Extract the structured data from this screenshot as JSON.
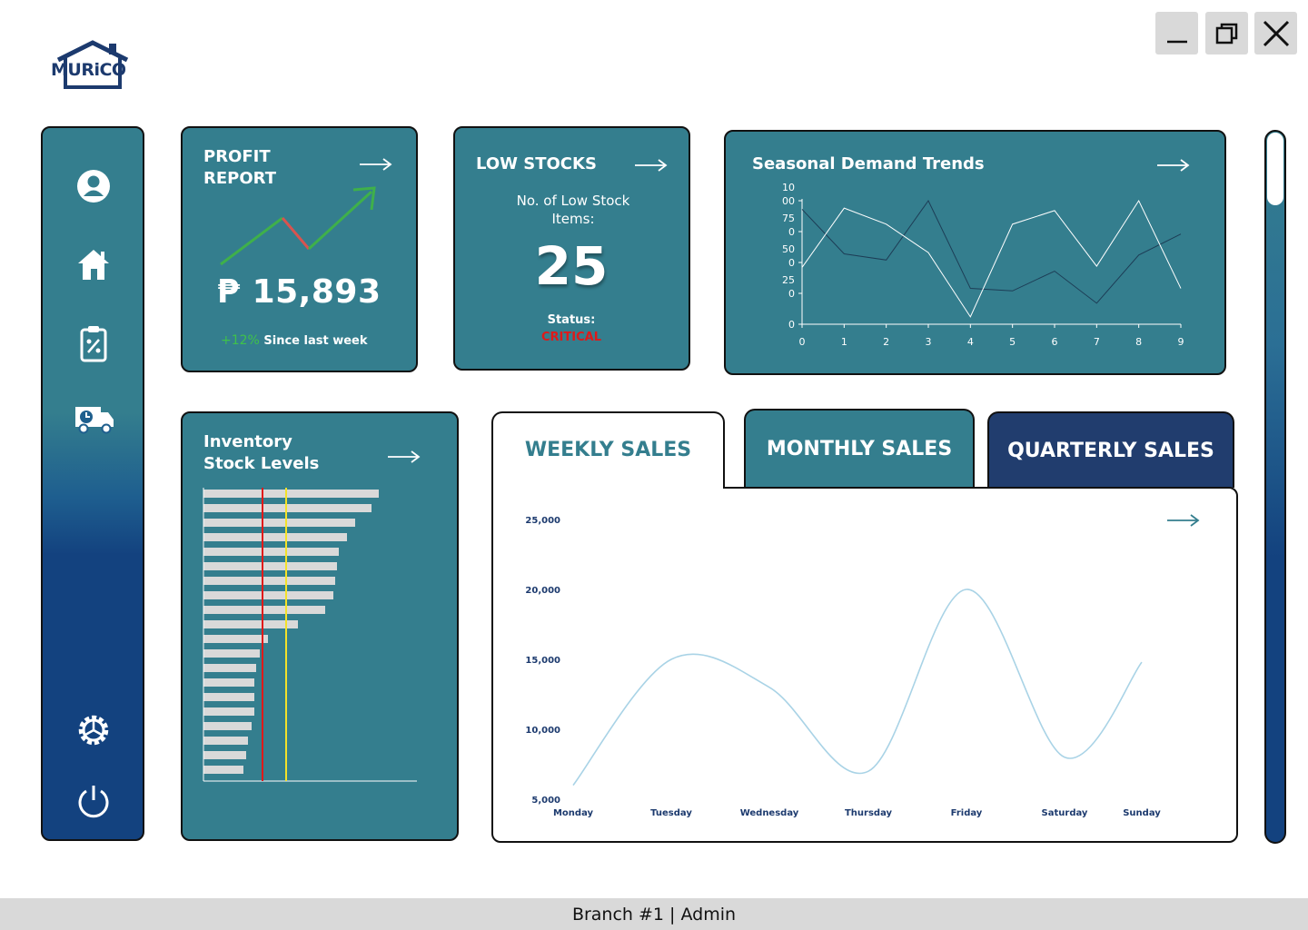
{
  "app": {
    "logo_text": "MURiCO"
  },
  "window_controls": {
    "minimize": "minimize-icon",
    "maximize": "maximize-icon",
    "close": "close-icon"
  },
  "sidebar": {
    "items": [
      {
        "icon": "user-icon"
      },
      {
        "icon": "home-icon"
      },
      {
        "icon": "clipboard-percent-icon"
      },
      {
        "icon": "delivery-truck-clock-icon"
      },
      {
        "icon": "settings-gear-icon"
      },
      {
        "icon": "power-icon"
      }
    ]
  },
  "profit_report": {
    "title_line1": "PROFIT",
    "title_line2": "REPORT",
    "value": "₱ 15,893",
    "change": "+12%",
    "change_label": "Since last week",
    "colors": {
      "up": "#3fb04a",
      "down": "#d9534f"
    }
  },
  "low_stocks": {
    "title": "LOW STOCKS",
    "subtitle_line1": "No. of Low Stock",
    "subtitle_line2": "Items:",
    "count": "25",
    "status_label": "Status:",
    "status_value": "CRITICAL",
    "status_color": "#e01919"
  },
  "seasonal": {
    "title": "Seasonal Demand Trends",
    "chart_data": {
      "type": "line",
      "x": [
        0,
        1,
        2,
        3,
        4,
        5,
        6,
        7,
        8,
        9
      ],
      "y_tick_labels": [
        "0",
        "25\n0",
        "50\n0",
        "75\n0",
        "10\n00"
      ],
      "ylim": [
        0,
        100
      ],
      "series": [
        {
          "values": [
            93,
            57,
            52,
            100,
            29,
            27,
            43,
            17,
            56,
            73
          ]
        },
        {
          "values": [
            46,
            94,
            81,
            58,
            6,
            81,
            92,
            47,
            100,
            29
          ]
        }
      ],
      "grid": false
    }
  },
  "inventory": {
    "title_line1": "Inventory",
    "title_line2": "Stock Levels",
    "chart_data": {
      "type": "bar",
      "orientation": "horizontal",
      "values": [
        193,
        185,
        167,
        158,
        149,
        147,
        145,
        143,
        134,
        104,
        71,
        62,
        58,
        56,
        56,
        56,
        53,
        49,
        47,
        44
      ],
      "xlim": [
        0,
        235
      ],
      "reference_lines": [
        {
          "value": 65,
          "color": "#e01919"
        },
        {
          "value": 91,
          "color": "#f4e229"
        }
      ],
      "bar_color": "#d9d9d9"
    }
  },
  "sales_tabs": {
    "weekly": "WEEKLY SALES",
    "monthly": "MONTHLY SALES",
    "quarterly": "QUARTERLY SALES",
    "active": "weekly"
  },
  "weekly_sales": {
    "chart_data": {
      "type": "line",
      "categories": [
        "Monday",
        "Tuesday",
        "Wednesday",
        "Thursday",
        "Friday",
        "Saturday",
        "Sunday"
      ],
      "values": [
        6000,
        15000,
        13000,
        7000,
        20000,
        8000,
        14800
      ],
      "ylim": [
        5000,
        25000
      ],
      "y_tick_labels": [
        "25,000",
        "20,000",
        "15,000",
        "10,000",
        "5,000"
      ],
      "line_color": "#a9d3e6",
      "smooth": true
    }
  },
  "footer": {
    "text": "Branch #1 | Admin"
  }
}
